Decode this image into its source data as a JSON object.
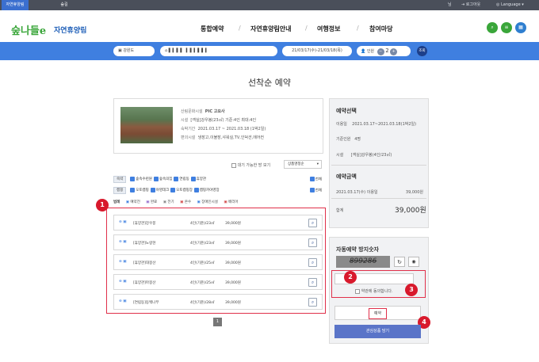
{
  "topbar": {
    "tabs": [
      "자연휴양림",
      "숲길"
    ],
    "user": "님",
    "logout": "로그아웃",
    "language": "Language"
  },
  "header": {
    "logo_mark": "숲나들e",
    "logo_text": "자연휴양림",
    "nav": [
      "통합예약",
      "자연휴양림안내",
      "여행정보",
      "참여마당"
    ],
    "sep": "/"
  },
  "searchbar": {
    "region": "강원도",
    "dates": "21/03/17(수)-21/03/18(목)",
    "people_label": "인원",
    "people_count": "2",
    "search": "조회",
    "minus": "−",
    "plus": "+"
  },
  "title": "선착순 예약",
  "facility": {
    "rows": [
      {
        "label": "산림문화시설",
        "value": "PIC 고요사"
      },
      {
        "label": "시설",
        "value": "[객실]강우봉(23㎡) 기준:4인 최대:4인"
      },
      {
        "label": "숙박기간",
        "value": "2021.03.17 ~ 2021.03.18 (1박2일)"
      },
      {
        "label": "편의시설",
        "value": "냉장고,이불장,샤워실,TV,인덕션,에어컨"
      }
    ]
  },
  "filters": {
    "available_only": "대기 가능한 방 보기",
    "sort": "상품명정순",
    "row1_tag": "숙박",
    "row1_items": [
      "숲속수련원",
      "숲속의집",
      "연립동",
      "휴양관"
    ],
    "row2_tag": "캠핑",
    "row2_items": [
      "오토캠핑",
      "야영데크",
      "오토캠핑장",
      "캠핑카야영장"
    ],
    "all": "전체",
    "legend_label": "범례",
    "legend": [
      "예약전",
      "완료",
      "전기",
      "온수",
      "장애인시설",
      "배리어"
    ]
  },
  "list": [
    {
      "name": "[휴양관]강우봉",
      "capacity": "4인(기준)/23㎡",
      "price": "39,000원"
    },
    {
      "name": "[휴양관]노랑현",
      "capacity": "4인(기준)/23㎡",
      "price": "39,000원"
    },
    {
      "name": "[휴양관]대봉산",
      "capacity": "4인(기준)/25㎡",
      "price": "39,000원"
    },
    {
      "name": "[휴양관]마봉산",
      "capacity": "4인(기준)/25㎡",
      "price": "39,000원"
    },
    {
      "name": "[연립동]동백나무",
      "capacity": "4인(기준)/28㎡",
      "price": "39,000원"
    }
  ],
  "pagination": [
    "1"
  ],
  "sidebar": {
    "selection_title": "예약선택",
    "selection_rows": [
      {
        "label": "이용일",
        "value": "2021.03.17~2021.03.18(1박2일)"
      },
      {
        "label": "기준인원",
        "value": "4명"
      },
      {
        "label": "시설",
        "value": "[객실]강우봉(4인/23㎡)"
      }
    ],
    "amount_title": "예약금액",
    "amount_row_label": "2021.03.17(수) 이용일",
    "amount_row_value": "39,000원",
    "total_label": "합계",
    "total_value": "39,000원",
    "captcha_title": "자동예약 방지숫자",
    "captcha_code": "899286",
    "agree_label": "약관에 동의합니다.",
    "reserve_button": "예약",
    "close_button": "관심상품 담기"
  },
  "annotations": [
    "1",
    "2",
    "3",
    "4"
  ],
  "colors": {
    "accent": "#3f7fe0",
    "annotation": "#d8192c",
    "topbar": "#4a4f5a"
  }
}
